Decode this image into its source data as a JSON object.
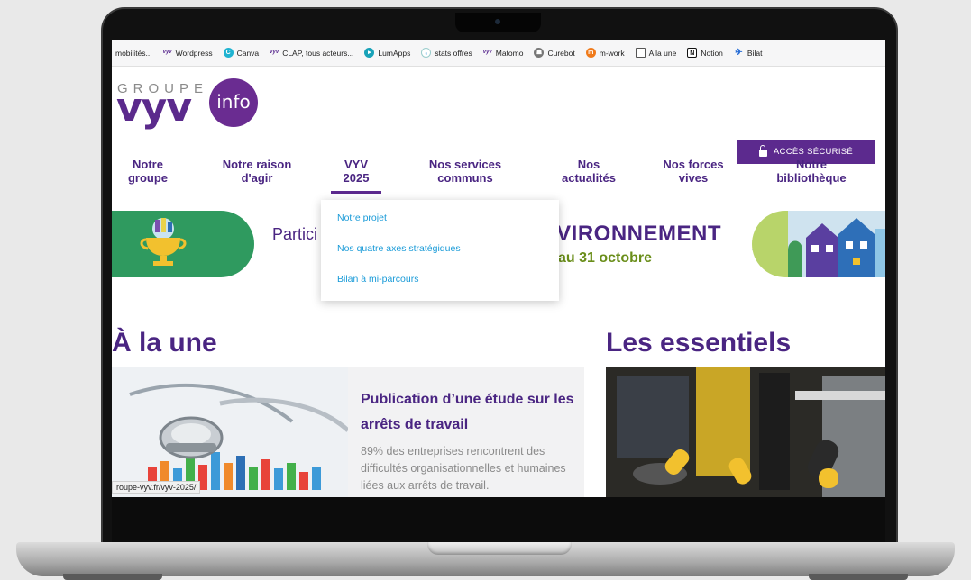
{
  "bookmarks": [
    {
      "label": "mobilités...",
      "icon": "none"
    },
    {
      "label": "Wordpress",
      "icon": "vyv-icon"
    },
    {
      "label": "Canva",
      "icon": "canva-icon"
    },
    {
      "label": "CLAP, tous acteurs...",
      "icon": "vyv-icon"
    },
    {
      "label": "LumApps",
      "icon": "lumapps-icon"
    },
    {
      "label": "stats offres",
      "icon": "stats-icon"
    },
    {
      "label": "Matomo",
      "icon": "vyv-icon"
    },
    {
      "label": "Curebot",
      "icon": "curebot-icon"
    },
    {
      "label": "m-work",
      "icon": "mwork-icon"
    },
    {
      "label": "A la une",
      "icon": "page-icon"
    },
    {
      "label": "Notion",
      "icon": "notion-icon"
    },
    {
      "label": "Bilat",
      "icon": "rocket-icon"
    }
  ],
  "logo": {
    "groupe": "GROUPE",
    "vyv": "vyv",
    "info": "info"
  },
  "header": {
    "secure_label": "ACCÈS SÉCURISÉ"
  },
  "nav": [
    {
      "line1": "Notre",
      "line2": "groupe"
    },
    {
      "line1": "Notre raison",
      "line2": "d'agir"
    },
    {
      "line1": "VYV",
      "line2": "2025"
    },
    {
      "line1": "Nos services",
      "line2": "communs"
    },
    {
      "line1": "Nos",
      "line2": "actualités"
    },
    {
      "line1": "Nos forces",
      "line2": "vives"
    },
    {
      "line1": "Notre",
      "line2": "bibliothèque"
    }
  ],
  "dropdown": {
    "items": [
      "Notre projet",
      "Nos quatre axes stratégiques",
      "Bilan à mi-parcours"
    ]
  },
  "banner": {
    "text_left": "Partici",
    "text_main": "IVIRONNEMENT",
    "text_date": "au 31 octobre"
  },
  "sections": {
    "une_title": "À la une",
    "essentiels_title": "Les essentiels"
  },
  "article": {
    "title": "Publication d’une étude sur les arrêts de travail",
    "description": "89% des entreprises rencontrent des difficultés organisationnelles et humaines liées aux arrêts de travail."
  },
  "status_url": "roupe-vyv.fr/vyv-2025/",
  "colors": {
    "brand_purple": "#5c2a8e",
    "link_blue": "#1a9bd8",
    "banner_green": "#2f9a5f",
    "banner_lime": "#b8d46a"
  }
}
